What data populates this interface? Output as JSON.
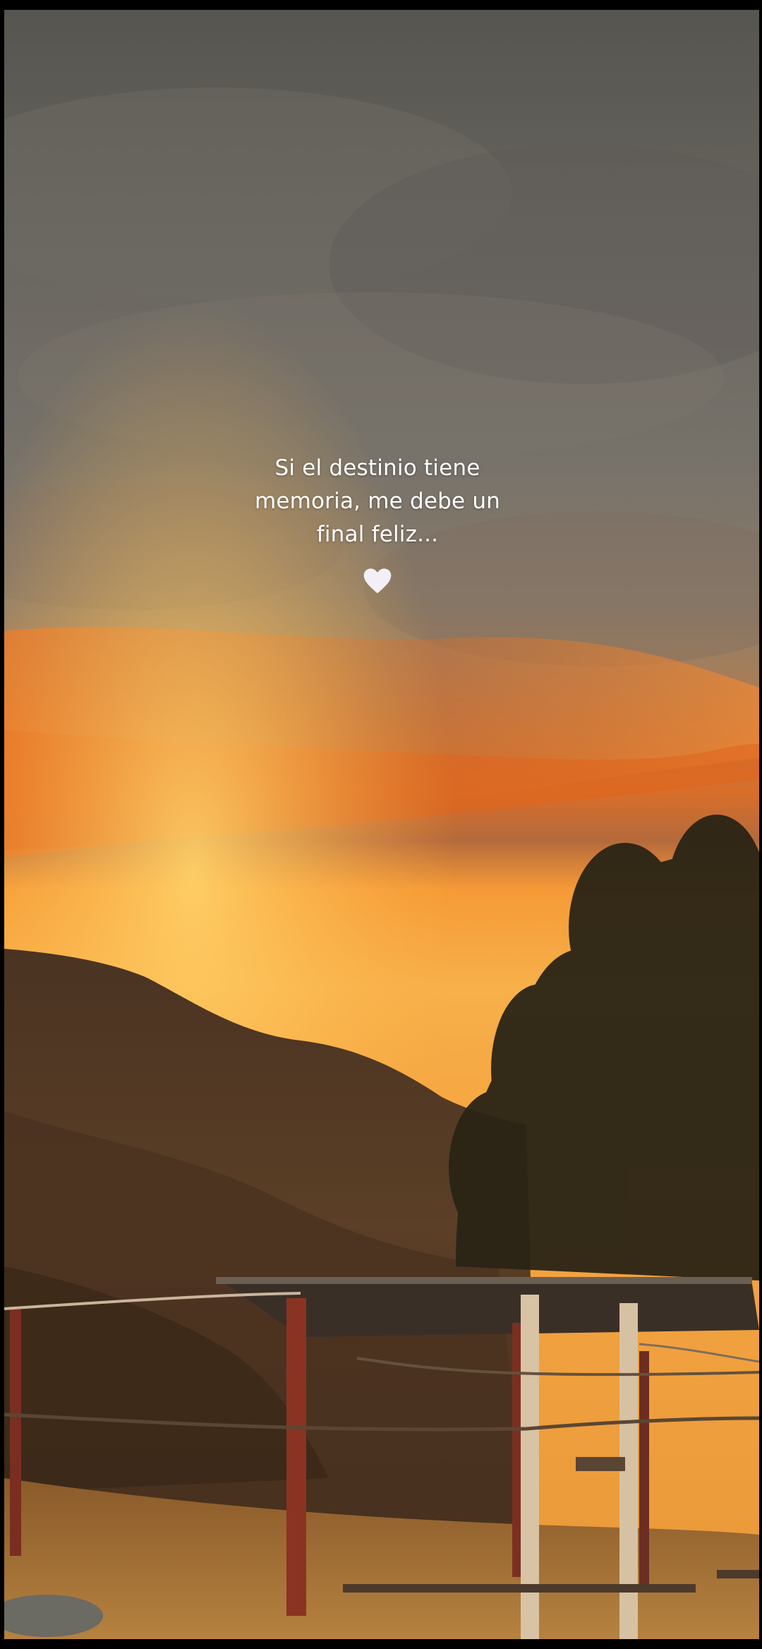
{
  "caption": {
    "text": "Si el destinio tiene memoria, me debe un final feliz..."
  },
  "heart": {
    "icon": "white-heart-icon",
    "color": "#f2f0f6"
  },
  "colors": {
    "sky_top": "#5b5a57",
    "sky_glow": "#f5a03a",
    "cloud_orange": "#e8772a",
    "ground": "#3a2612"
  }
}
